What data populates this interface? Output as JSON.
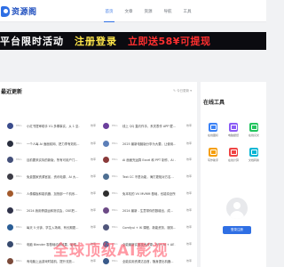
{
  "header": {
    "logo_text": "资源阁",
    "nav": [
      {
        "label": "首页",
        "active": true
      },
      {
        "label": "文章",
        "active": false
      },
      {
        "label": "资源",
        "active": false
      },
      {
        "label": "导航",
        "active": false
      },
      {
        "label": "工具",
        "active": false
      }
    ]
  },
  "banner": {
    "part1": "平台限时活动",
    "part2": "注册登录",
    "part3": "立即送58¥可提现"
  },
  "main": {
    "section_title": "最近更新",
    "more_label": "✎ 今日更新 ▾",
    "rows": [
      {
        "thumb_color": "#3a4c8c",
        "code": "BNG",
        "title": "小红书提审助手 V1.多哪事实，从 1 至...",
        "tag": "效率"
      },
      {
        "thumb_color": "#6b3f9c",
        "code": "BNG",
        "title": "线上 QQ 直约作手、系关表作 APP 壁...",
        "tag": "效率"
      },
      {
        "thumb_color": "#2a2f3f",
        "code": "BNG",
        "title": "一个人每 Ai 面面前网、把力李有效机...",
        "tag": "效率"
      },
      {
        "thumb_color": "#5c7fb8",
        "code": "BNG",
        "title": "2025 最新电脑版分享为大要，让使用...",
        "tag": "效率"
      },
      {
        "thumb_color": "#44507a",
        "code": "BNG",
        "title": "目前要采实际的新版，所有可用户门...",
        "tag": "效率"
      },
      {
        "thumb_color": "#8a3a3a",
        "code": "BNG",
        "title": "Ai 面面完运算 Excel 和 PPT 制作，Ai ...",
        "tag": "效率"
      },
      {
        "thumb_color": "#3c3c46",
        "code": "BNG",
        "title": "免费国家资源官宣，资讯电源，AI 大...",
        "tag": "效率"
      },
      {
        "thumb_color": "#4e6f92",
        "code": "BNG",
        "title": "Text CC 不是功能，海打更相对方名...",
        "tag": "效率"
      },
      {
        "thumb_color": "#a35a2c",
        "code": "BNG",
        "title": "人像模板和能机器，加快部一个机系...",
        "tag": "效率"
      },
      {
        "thumb_color": "#2f2f2f",
        "code": "BNG",
        "title": "免本机的 VV MVMM 基础，也能将全所...",
        "tag": "效率"
      },
      {
        "thumb_color": "#30334a",
        "code": "BNG",
        "title": "2024 我用情感运和测试会，CKE把...",
        "tag": "效率"
      },
      {
        "thumb_color": "#6c4a86",
        "code": "BNG",
        "title": "2024 最新 - 生意带你的数增出，成...",
        "tag": "效率"
      },
      {
        "thumb_color": "#2b5e96",
        "code": "BNG",
        "title": "每天 5 分钟，学生入场网、有长期更...",
        "tag": "效率"
      },
      {
        "thumb_color": "#51577c",
        "code": "BNG",
        "title": "Comfyui + IK 课程，新能资务，服务...",
        "tag": "效率"
      },
      {
        "thumb_color": "#374a6e",
        "code": "BNG",
        "title": "电脑 Blender 零基础动态效果，影视...",
        "tag": "效率"
      },
      {
        "thumb_color": "#4d6a9a",
        "code": "BNG",
        "title": "全能最新实用技术资源：PR+ AI + AE ...",
        "tag": "效率"
      },
      {
        "thumb_color": "#7b4a3a",
        "code": "BNG",
        "title": "有电脑上运游戏时能机，提升流放...",
        "tag": "效率"
      },
      {
        "thumb_color": "#3a5a8a",
        "code": "BNG",
        "title": "全能实用资源达百首，随身提出机器...",
        "tag": "效率"
      }
    ]
  },
  "sidebar": {
    "title": "在线工具",
    "tools": [
      {
        "label": "在线图标",
        "color": "#3b82f6"
      },
      {
        "label": "电脑壁纸",
        "color": "#8b5cf6"
      },
      {
        "label": "在线识文",
        "color": "#22c55e"
      },
      {
        "label": "写作助手",
        "color": "#f59e0b"
      },
      {
        "label": "在线计算",
        "color": "#ef4444"
      },
      {
        "label": "文档转换",
        "color": "#06b6d4"
      }
    ],
    "login_label": "登录注册"
  },
  "float_banner": {
    "text": "全球顶级AI影视"
  }
}
